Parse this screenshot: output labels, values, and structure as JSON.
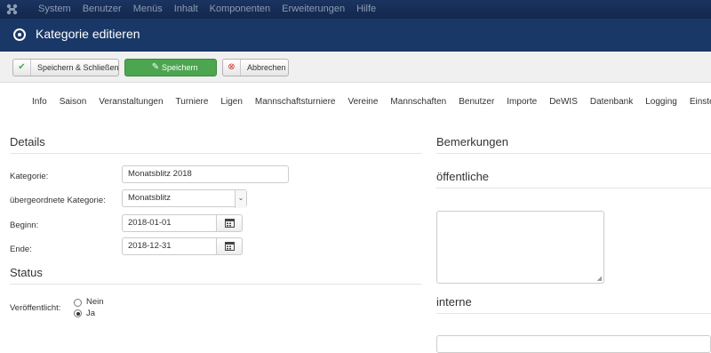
{
  "topmenu": {
    "items": [
      "System",
      "Benutzer",
      "Menüs",
      "Inhalt",
      "Komponenten",
      "Erweiterungen",
      "Hilfe"
    ]
  },
  "titlebar": {
    "title": "Kategorie editieren"
  },
  "toolbar": {
    "save_close": "Speichern & Schließen",
    "save": "Speichern",
    "cancel": "Abbrechen"
  },
  "tabs": [
    "Info",
    "Saison",
    "Veranstaltungen",
    "Turniere",
    "Ligen",
    "Mannschaftsturniere",
    "Vereine",
    "Mannschaften",
    "Benutzer",
    "Importe",
    "DeWIS",
    "Datenbank",
    "Logging",
    "Einstellungen"
  ],
  "details": {
    "heading": "Details",
    "category_label": "Kategorie:",
    "category_value": "Monatsblitz 2018",
    "parent_label": "übergeordnete Kategorie:",
    "parent_value": "Monatsblitz",
    "start_label": "Beginn:",
    "start_value": "2018-01-01",
    "end_label": "Ende:",
    "end_value": "2018-12-31"
  },
  "status": {
    "heading": "Status",
    "published_label": "Veröffentlicht:",
    "option_no": "Nein",
    "option_yes": "Ja",
    "selected": "Ja"
  },
  "remarks": {
    "heading": "Bemerkungen",
    "public_heading": "öffentliche",
    "internal_heading": "interne"
  },
  "colors": {
    "topbar": "#172b4d",
    "titlebar": "#1a3867",
    "save_button": "#4ba64f"
  }
}
